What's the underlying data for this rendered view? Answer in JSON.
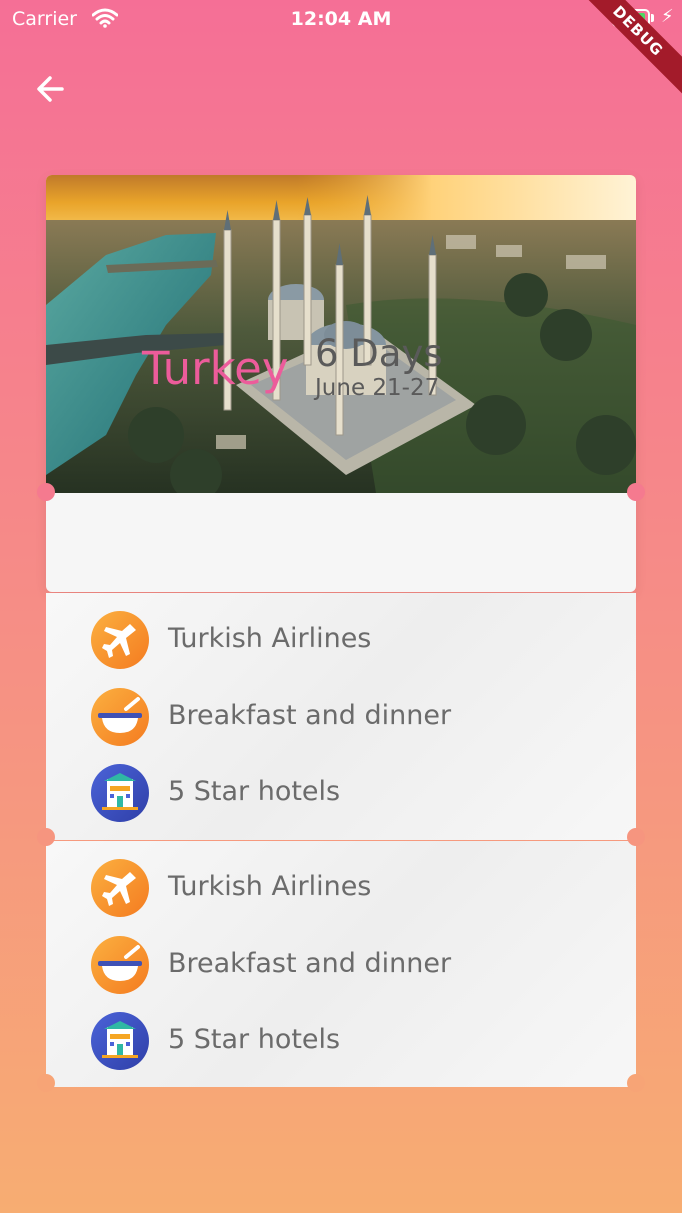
{
  "status_bar": {
    "carrier": "Carrier",
    "time": "12:04 AM",
    "battery_level": 0.95,
    "debug_label": "DEBUG"
  },
  "nav": {
    "back_icon": "arrow-left-icon"
  },
  "colors": {
    "gradient_top": "#f56f96",
    "gradient_bottom": "#f7ad72",
    "destination": "#ec5c9b",
    "card": "#f6f6f6",
    "debug_banner": "#a31b2a"
  },
  "trip": {
    "destination": "Turkey",
    "duration": "6 Days",
    "dates": "June 21-27",
    "image": "istanbul-mosque-aerial"
  },
  "sections": [
    {
      "features": [
        {
          "icon": "airplane-icon",
          "label": "Turkish Airlines"
        },
        {
          "icon": "meal-bowl-icon",
          "label": "Breakfast and dinner"
        },
        {
          "icon": "hotel-icon",
          "label": "5 Star hotels"
        }
      ]
    },
    {
      "features": [
        {
          "icon": "airplane-icon",
          "label": "Turkish Airlines"
        },
        {
          "icon": "meal-bowl-icon",
          "label": "Breakfast and dinner"
        },
        {
          "icon": "hotel-icon",
          "label": "5 Star hotels"
        }
      ]
    }
  ]
}
